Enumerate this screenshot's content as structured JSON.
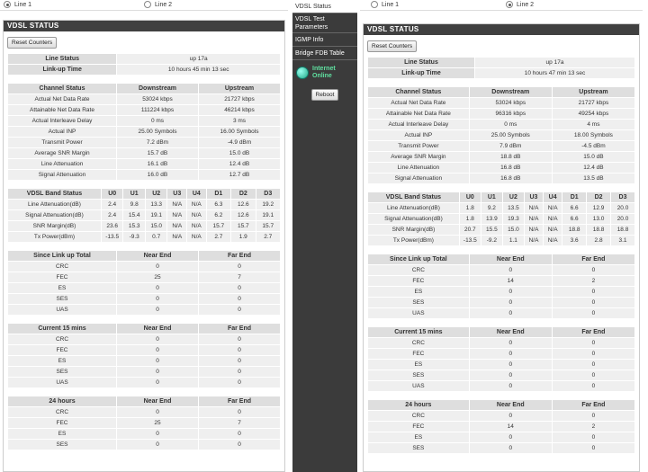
{
  "line_options": [
    "Line 1",
    "Line 2"
  ],
  "nav": {
    "items": [
      "VDSL Status",
      "VDSL Test Parameters",
      "IGMP Info",
      "Bridge FDB Table"
    ],
    "internet_status": [
      "Internet",
      "Online"
    ],
    "reboot_label": "Reboot"
  },
  "panels": [
    {
      "selected_line": "Line 1",
      "title": "VDSL STATUS",
      "reset_label": "Reset Counters",
      "line_status": {
        "rows": [
          [
            "Line Status",
            "up 17a"
          ],
          [
            "Link-up Time",
            "10 hours 45 min 13 sec"
          ]
        ]
      },
      "channel": {
        "headers": [
          "Channel Status",
          "Downstream",
          "Upstream"
        ],
        "rows": [
          [
            "Actual Net Data Rate",
            "53024 kbps",
            "21727 kbps"
          ],
          [
            "Attainable Net Data Rate",
            "111224 kbps",
            "46214 kbps"
          ],
          [
            "Actual Interleave Delay",
            "0 ms",
            "3 ms"
          ],
          [
            "Actual INP",
            "25.00 Symbols",
            "16.00 Symbols"
          ],
          [
            "Transmit Power",
            "7.2 dBm",
            "-4.9 dBm"
          ],
          [
            "Average SNR Margin",
            "15.7 dB",
            "15.0 dB"
          ],
          [
            "Line Attenuation",
            "16.1 dB",
            "12.4 dB"
          ],
          [
            "Signal Attenuation",
            "16.0 dB",
            "12.7 dB"
          ]
        ]
      },
      "band": {
        "headers": [
          "VDSL Band Status",
          "U0",
          "U1",
          "U2",
          "U3",
          "U4",
          "D1",
          "D2",
          "D3"
        ],
        "rows": [
          [
            "Line Attenuation(dB)",
            "2.4",
            "9.8",
            "13.3",
            "N/A",
            "N/A",
            "6.3",
            "12.6",
            "19.2"
          ],
          [
            "Signal Attenuation(dB)",
            "2.4",
            "15.4",
            "19.1",
            "N/A",
            "N/A",
            "6.2",
            "12.6",
            "19.1"
          ],
          [
            "SNR Margin(dB)",
            "23.6",
            "15.3",
            "15.0",
            "N/A",
            "N/A",
            "15.7",
            "15.7",
            "15.7"
          ],
          [
            "Tx Power(dBm)",
            "-13.5",
            "-9.3",
            "0.7",
            "N/A",
            "N/A",
            "2.7",
            "1.9",
            "2.7"
          ]
        ]
      },
      "counters": [
        {
          "headers": [
            "Since Link up Total",
            "Near End",
            "Far End"
          ],
          "rows": [
            [
              "CRC",
              "0",
              "0"
            ],
            [
              "FEC",
              "25",
              "7"
            ],
            [
              "ES",
              "0",
              "0"
            ],
            [
              "SES",
              "0",
              "0"
            ],
            [
              "UAS",
              "0",
              "0"
            ]
          ]
        },
        {
          "headers": [
            "Current 15 mins",
            "Near End",
            "Far End"
          ],
          "rows": [
            [
              "CRC",
              "0",
              "0"
            ],
            [
              "FEC",
              "0",
              "0"
            ],
            [
              "ES",
              "0",
              "0"
            ],
            [
              "SES",
              "0",
              "0"
            ],
            [
              "UAS",
              "0",
              "0"
            ]
          ]
        },
        {
          "headers": [
            "24 hours",
            "Near End",
            "Far End"
          ],
          "rows": [
            [
              "CRC",
              "0",
              "0"
            ],
            [
              "FEC",
              "25",
              "7"
            ],
            [
              "ES",
              "0",
              "0"
            ],
            [
              "SES",
              "0",
              "0"
            ]
          ]
        }
      ]
    },
    {
      "selected_line": "Line 2",
      "title": "VDSL STATUS",
      "reset_label": "Reset Counters",
      "line_status": {
        "rows": [
          [
            "Line Status",
            "up 17a"
          ],
          [
            "Link-up Time",
            "10 hours 47 min 13 sec"
          ]
        ]
      },
      "channel": {
        "headers": [
          "Channel Status",
          "Downstream",
          "Upstream"
        ],
        "rows": [
          [
            "Actual Net Data Rate",
            "53024 kbps",
            "21727 kbps"
          ],
          [
            "Attainable Net Data Rate",
            "96316 kbps",
            "49254 kbps"
          ],
          [
            "Actual Interleave Delay",
            "0 ms",
            "4 ms"
          ],
          [
            "Actual INP",
            "25.00 Symbols",
            "18.00 Symbols"
          ],
          [
            "Transmit Power",
            "7.9 dBm",
            "-4.5 dBm"
          ],
          [
            "Average SNR Margin",
            "18.8 dB",
            "15.0 dB"
          ],
          [
            "Line Attenuation",
            "16.8 dB",
            "12.4 dB"
          ],
          [
            "Signal Attenuation",
            "16.8 dB",
            "13.5 dB"
          ]
        ]
      },
      "band": {
        "headers": [
          "VDSL Band Status",
          "U0",
          "U1",
          "U2",
          "U3",
          "U4",
          "D1",
          "D2",
          "D3"
        ],
        "rows": [
          [
            "Line Attenuation(dB)",
            "1.8",
            "9.2",
            "13.5",
            "N/A",
            "N/A",
            "6.6",
            "12.9",
            "20.0"
          ],
          [
            "Signal Attenuation(dB)",
            "1.8",
            "13.9",
            "19.3",
            "N/A",
            "N/A",
            "6.6",
            "13.0",
            "20.0"
          ],
          [
            "SNR Margin(dB)",
            "20.7",
            "15.5",
            "15.0",
            "N/A",
            "N/A",
            "18.8",
            "18.8",
            "18.8"
          ],
          [
            "Tx Power(dBm)",
            "-13.5",
            "-9.2",
            "1.1",
            "N/A",
            "N/A",
            "3.6",
            "2.8",
            "3.1"
          ]
        ]
      },
      "counters": [
        {
          "headers": [
            "Since Link up Total",
            "Near End",
            "Far End"
          ],
          "rows": [
            [
              "CRC",
              "0",
              "0"
            ],
            [
              "FEC",
              "14",
              "2"
            ],
            [
              "ES",
              "0",
              "0"
            ],
            [
              "SES",
              "0",
              "0"
            ],
            [
              "UAS",
              "0",
              "0"
            ]
          ]
        },
        {
          "headers": [
            "Current 15 mins",
            "Near End",
            "Far End"
          ],
          "rows": [
            [
              "CRC",
              "0",
              "0"
            ],
            [
              "FEC",
              "0",
              "0"
            ],
            [
              "ES",
              "0",
              "0"
            ],
            [
              "SES",
              "0",
              "0"
            ],
            [
              "UAS",
              "0",
              "0"
            ]
          ]
        },
        {
          "headers": [
            "24 hours",
            "Near End",
            "Far End"
          ],
          "rows": [
            [
              "CRC",
              "0",
              "0"
            ],
            [
              "FEC",
              "14",
              "2"
            ],
            [
              "ES",
              "0",
              "0"
            ],
            [
              "SES",
              "0",
              "0"
            ]
          ]
        }
      ]
    }
  ]
}
